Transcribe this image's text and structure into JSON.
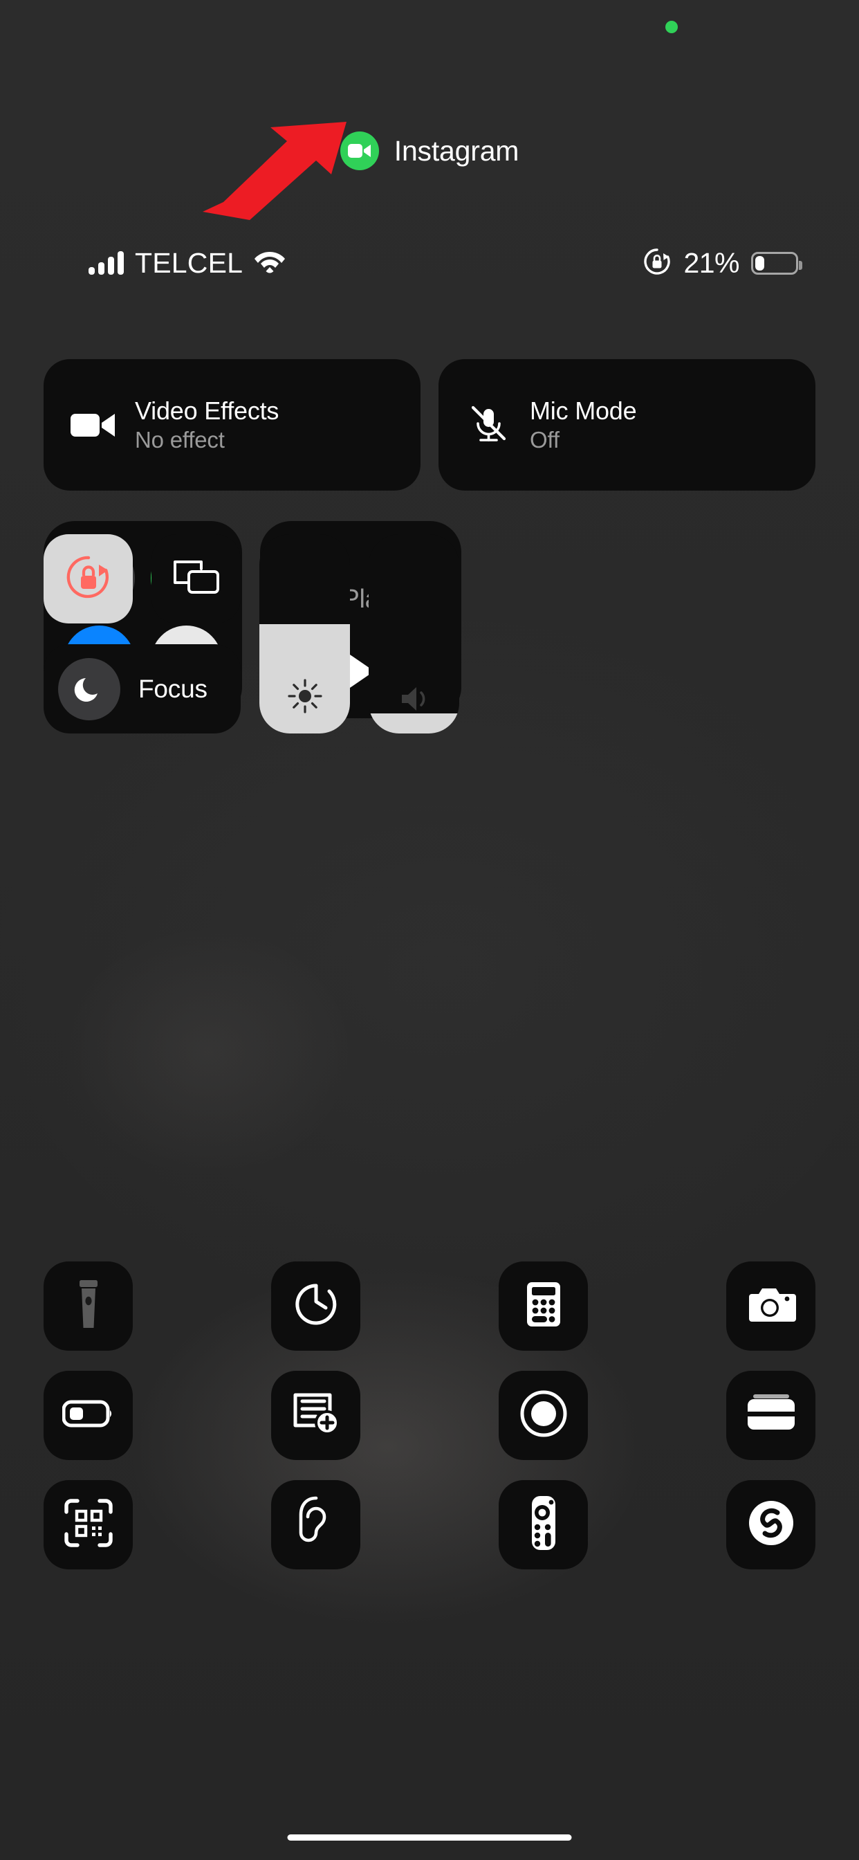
{
  "status_bar": {
    "carrier": "TELCEL",
    "battery_percent": "21%",
    "battery_level": 21,
    "signal_bars": 4,
    "wifi_icon": "wifi-icon",
    "rotation_lock_icon": "rotation-lock-icon",
    "battery_icon": "battery-icon"
  },
  "recording_indicator": {
    "icon": "green-recording-dot",
    "color": "#30d158"
  },
  "app_banner": {
    "name": "Instagram",
    "badge_icon": "video-camera-icon",
    "badge_color": "#30d158"
  },
  "effects_row": {
    "video_effects": {
      "title": "Video Effects",
      "subtitle": "No effect",
      "icon": "video-camera-icon"
    },
    "mic_mode": {
      "title": "Mic Mode",
      "subtitle": "Off",
      "icon": "mic-slash-icon"
    }
  },
  "connectivity": {
    "buttons": [
      {
        "name": "airplane-mode",
        "icon": "airplane-icon",
        "state": "off",
        "color": "#3a3a3c"
      },
      {
        "name": "cellular-data",
        "icon": "cellular-antenna-icon",
        "state": "on",
        "color": "#30d158"
      },
      {
        "name": "wifi",
        "icon": "wifi-icon",
        "state": "on",
        "color": "#0a84ff"
      },
      {
        "name": "bluetooth",
        "icon": "bluetooth-icon",
        "state": "on",
        "color": "#e8e8e8"
      }
    ]
  },
  "now_playing": {
    "title": "Not Playing",
    "airplay_icon": "airplay-audio-icon",
    "controls": [
      {
        "name": "rewind",
        "icon": "rewind-icon"
      },
      {
        "name": "play",
        "icon": "play-icon"
      },
      {
        "name": "fast-forward",
        "icon": "fast-forward-icon"
      }
    ]
  },
  "toggles": {
    "rotation_lock": {
      "icon": "rotation-lock-icon",
      "state": "on",
      "tint": "#ff6961"
    },
    "screen_mirroring": {
      "icon": "screen-mirroring-icon",
      "state": "off"
    },
    "focus": {
      "label": "Focus",
      "icon": "moon-icon",
      "state": "off"
    }
  },
  "sliders": {
    "brightness": {
      "icon": "brightness-sun-icon",
      "value": 55
    },
    "volume": {
      "icon": "speaker-wave-icon",
      "value": 10
    }
  },
  "utilities": [
    {
      "name": "flashlight",
      "icon": "flashlight-icon",
      "state": "off"
    },
    {
      "name": "timer",
      "icon": "timer-icon",
      "state": "off"
    },
    {
      "name": "calculator",
      "icon": "calculator-icon",
      "state": "off"
    },
    {
      "name": "camera",
      "icon": "camera-icon",
      "state": "off"
    },
    {
      "name": "low-power-mode",
      "icon": "battery-low-power-icon",
      "state": "off"
    },
    {
      "name": "quick-note",
      "icon": "quick-note-icon",
      "state": "off"
    },
    {
      "name": "screen-recording",
      "icon": "screen-record-icon",
      "state": "off"
    },
    {
      "name": "wallet",
      "icon": "wallet-icon",
      "state": "off"
    },
    {
      "name": "code-scanner",
      "icon": "qr-code-scanner-icon",
      "state": "off"
    },
    {
      "name": "hearing",
      "icon": "ear-hearing-icon",
      "state": "off"
    },
    {
      "name": "apple-tv-remote",
      "icon": "tv-remote-icon",
      "state": "off"
    },
    {
      "name": "shazam-music-recognition",
      "icon": "shazam-icon",
      "state": "off"
    }
  ],
  "annotation": {
    "arrow_color": "#ed1c24",
    "points_to": "video-effects-tile"
  },
  "home_indicator": {
    "name": "home-indicator"
  }
}
